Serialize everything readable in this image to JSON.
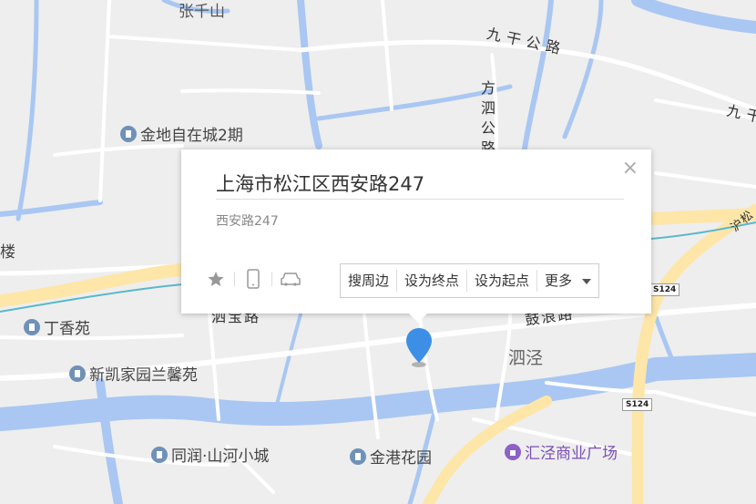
{
  "map": {
    "colors": {
      "background": "#eeeeee",
      "road": "#ffffff",
      "highway": "#fde6a8",
      "river": "#a9c7f2",
      "rail": "#5bb8c8"
    },
    "labels": {
      "zhangganshan": "张千山",
      "jiuganlu": "九干公路",
      "jiuganlu2": "九干",
      "fangsigonglu": "方泗公路",
      "jindi": "金地自在城2期",
      "dingxiangyuan": "丁香苑",
      "xinkai": "新凯家园兰馨苑",
      "sijing": "泗泾",
      "tongrun": "同润·山河小城",
      "jingang": "金港花园",
      "huijing": "汇泾商业广场",
      "s124a": "S124",
      "s124b": "S124",
      "roadleft": "泗宝路",
      "roadright": "鼓浪路",
      "edge_left": "楼",
      "edge_right": "沪松"
    },
    "poi_icons": {
      "jindi": "building-icon",
      "dingxiangyuan": "building-icon",
      "xinkai": "building-icon",
      "tongrun": "building-icon",
      "jingang": "building-icon",
      "huijing": "shopping-icon"
    }
  },
  "popup": {
    "title": "上海市松江区西安路247",
    "address": "西安路247",
    "close": "×",
    "icons": [
      "star-icon",
      "phone-icon",
      "car-icon"
    ],
    "actions": {
      "nearby": "搜周边",
      "set_end": "设为终点",
      "set_start": "设为起点",
      "more": "更多"
    }
  },
  "marker": {
    "color": "#3d8fe6",
    "icon": "location-pin-icon"
  }
}
